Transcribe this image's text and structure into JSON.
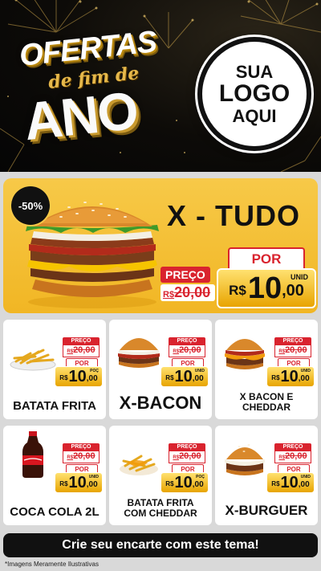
{
  "header": {
    "logo_line1": "OFERTAS",
    "logo_line2": "de fim de",
    "logo_line3": "ANO",
    "placeholder_line1": "SUA",
    "placeholder_line2": "LOGO",
    "placeholder_line3": "AQUI"
  },
  "feature": {
    "discount": "-50%",
    "title": "X - TUDO",
    "preco_label": "PREÇO",
    "old_currency": "R$",
    "old_value": "20,00",
    "por_label": "POR",
    "new_currency": "R$",
    "new_int": "10",
    "new_cents": ",00",
    "unit": "UNID"
  },
  "products": [
    {
      "name": "BATATA FRITA",
      "preco_label": "PREÇO",
      "old_currency": "R$",
      "old_value": "20,00",
      "por_label": "POR",
      "new_currency": "R$",
      "new_int": "10",
      "new_cents": ",00",
      "unit": "POÇ",
      "icon": "fries-icon"
    },
    {
      "name": "X-BACON",
      "preco_label": "PREÇO",
      "old_currency": "R$",
      "old_value": "20,00",
      "por_label": "POR",
      "new_currency": "R$",
      "new_int": "10",
      "new_cents": ",00",
      "unit": "UNID",
      "icon": "burger-icon"
    },
    {
      "name": "X BACON E CHEDDAR",
      "preco_label": "PREÇO",
      "old_currency": "R$",
      "old_value": "20,00",
      "por_label": "POR",
      "new_currency": "R$",
      "new_int": "10",
      "new_cents": ",00",
      "unit": "UNID",
      "icon": "cheddar-burger-icon"
    },
    {
      "name": "COCA COLA 2L",
      "preco_label": "PREÇO",
      "old_currency": "R$",
      "old_value": "20,00",
      "por_label": "POR",
      "new_currency": "R$",
      "new_int": "10",
      "new_cents": ",00",
      "unit": "UNID",
      "icon": "soda-bottle-icon"
    },
    {
      "name": "BATATA FRITA COM CHEDDAR",
      "preco_label": "PREÇO",
      "old_currency": "R$",
      "old_value": "20,00",
      "por_label": "POR",
      "new_currency": "R$",
      "new_int": "10",
      "new_cents": ",00",
      "unit": "POÇ",
      "icon": "cheddar-fries-icon"
    },
    {
      "name": "X-BURGUER",
      "preco_label": "PREÇO",
      "old_currency": "R$",
      "old_value": "20,00",
      "por_label": "POR",
      "new_currency": "R$",
      "new_int": "10",
      "new_cents": ",00",
      "unit": "UNID",
      "icon": "cheeseburger-icon"
    }
  ],
  "footer": {
    "cta": "Crie seu encarte com este tema!",
    "disclaimer": "*Imagens Meramente Ilustrativas"
  },
  "colors": {
    "accent_red": "#d9232e",
    "feature_yellow": "#f7c948",
    "price_gold": "#e8a400",
    "header_bg": "#0d0b08"
  }
}
